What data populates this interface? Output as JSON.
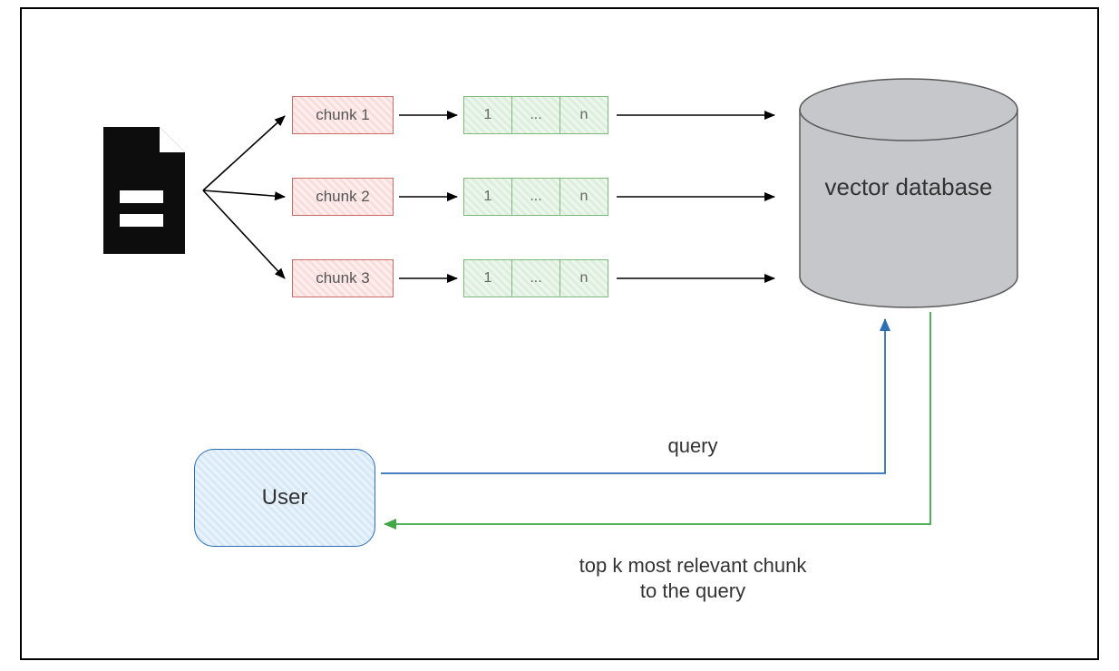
{
  "chunks": {
    "c1": "chunk 1",
    "c2": "chunk 2",
    "c3": "chunk 3"
  },
  "vector_cells": {
    "first": "1",
    "mid": "...",
    "last": "n"
  },
  "database_label": "vector\ndatabase",
  "user_label": "User",
  "query_label": "query",
  "result_label": "top k most relevant chunk\nto the query",
  "colors": {
    "chunk_border": "#c96b6b",
    "chunk_fill": "#fdeeee",
    "vec_border": "#7fb57f",
    "vec_fill": "#ecf6ec",
    "user_border": "#2d6fb5",
    "user_fill": "#e9f3fb",
    "db_fill": "#c6c7cb",
    "arrow_black": "#000000",
    "arrow_blue": "#2d6fb5",
    "arrow_green": "#3fa845"
  }
}
